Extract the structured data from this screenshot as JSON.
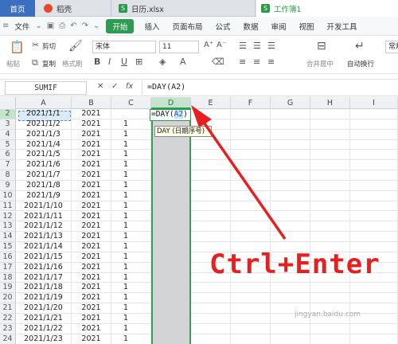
{
  "tabs": [
    {
      "label": "首页"
    },
    {
      "label": "稻壳"
    },
    {
      "label": "日历.xlsx"
    },
    {
      "label": "工作簿1"
    }
  ],
  "menu": {
    "file": "文件",
    "items": [
      "开始",
      "插入",
      "页面布局",
      "公式",
      "数据",
      "审阅",
      "视图",
      "开发工具"
    ]
  },
  "ribbon": {
    "cut": "剪切",
    "copy": "复制",
    "paste": "粘贴",
    "format_painter": "格式刷",
    "font_name": "宋体",
    "font_size": "11",
    "merge": "合并居中",
    "wrap": "自动换行",
    "number_format": "常规"
  },
  "formula_bar": {
    "name_box": "SUMIF",
    "fx": "fx",
    "formula": "=DAY(A2)"
  },
  "columns": [
    "A",
    "B",
    "C",
    "D",
    "E",
    "F",
    "G",
    "H",
    "I"
  ],
  "rows": [
    {
      "n": "2",
      "a": "2021/1/1",
      "b": "2021",
      "c": ""
    },
    {
      "n": "3",
      "a": "2021/1/2",
      "b": "2021",
      "c": "1"
    },
    {
      "n": "4",
      "a": "2021/1/3",
      "b": "2021",
      "c": "1"
    },
    {
      "n": "5",
      "a": "2021/1/4",
      "b": "2021",
      "c": "1"
    },
    {
      "n": "6",
      "a": "2021/1/5",
      "b": "2021",
      "c": "1"
    },
    {
      "n": "7",
      "a": "2021/1/6",
      "b": "2021",
      "c": "1"
    },
    {
      "n": "8",
      "a": "2021/1/7",
      "b": "2021",
      "c": "1"
    },
    {
      "n": "9",
      "a": "2021/1/8",
      "b": "2021",
      "c": "1"
    },
    {
      "n": "10",
      "a": "2021/1/9",
      "b": "2021",
      "c": "1"
    },
    {
      "n": "11",
      "a": "2021/1/10",
      "b": "2021",
      "c": "1"
    },
    {
      "n": "12",
      "a": "2021/1/11",
      "b": "2021",
      "c": "1"
    },
    {
      "n": "13",
      "a": "2021/1/12",
      "b": "2021",
      "c": "1"
    },
    {
      "n": "14",
      "a": "2021/1/13",
      "b": "2021",
      "c": "1"
    },
    {
      "n": "15",
      "a": "2021/1/14",
      "b": "2021",
      "c": "1"
    },
    {
      "n": "16",
      "a": "2021/1/15",
      "b": "2021",
      "c": "1"
    },
    {
      "n": "17",
      "a": "2021/1/16",
      "b": "2021",
      "c": "1"
    },
    {
      "n": "18",
      "a": "2021/1/17",
      "b": "2021",
      "c": "1"
    },
    {
      "n": "19",
      "a": "2021/1/18",
      "b": "2021",
      "c": "1"
    },
    {
      "n": "20",
      "a": "2021/1/19",
      "b": "2021",
      "c": "1"
    },
    {
      "n": "21",
      "a": "2021/1/20",
      "b": "2021",
      "c": "1"
    },
    {
      "n": "22",
      "a": "2021/1/21",
      "b": "2021",
      "c": "1"
    },
    {
      "n": "23",
      "a": "2021/1/22",
      "b": "2021",
      "c": "1"
    },
    {
      "n": "24",
      "a": "2021/1/23",
      "b": "2021",
      "c": "1"
    }
  ],
  "cell_editor": {
    "prefix": "=DAY(",
    "ref": "A2",
    "suffix": ")"
  },
  "tooltip": "DAY (日期序号)",
  "annotation": "Ctrl+Enter",
  "watermark": "jingyan.baidu.com",
  "colors": {
    "accent": "#2d9b52",
    "annotation": "#e62020",
    "selected_column": "#d2d4d6"
  }
}
